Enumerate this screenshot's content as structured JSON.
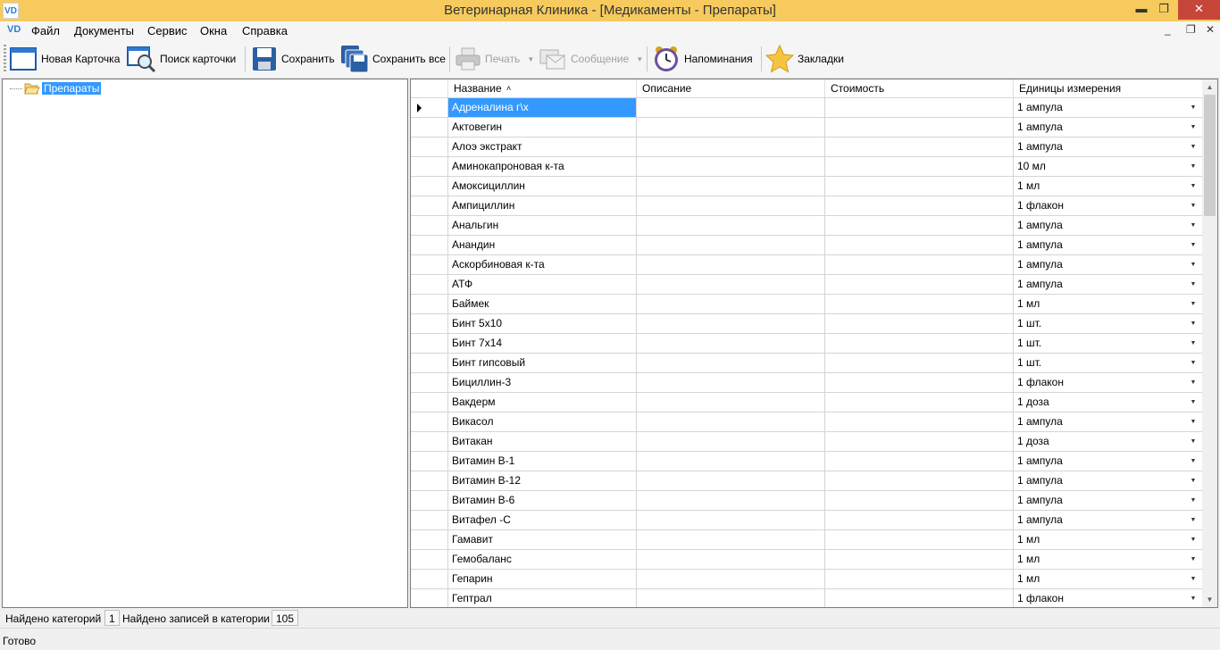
{
  "window": {
    "app_icon_text": "VD",
    "title": "Ветеринарная Клиника - [Медикаменты - Препараты]",
    "minimize": "▬",
    "maximize": "❐",
    "close": "✕"
  },
  "menu": {
    "icon_text": "VD",
    "items": [
      "Файл",
      "Документы",
      "Сервис",
      "Окна",
      "Справка"
    ],
    "mdi_minimize": "_",
    "mdi_restore": "❐",
    "mdi_close": "✕"
  },
  "toolbar": {
    "new_card": "Новая Карточка",
    "search_card": "Поиск карточки",
    "save": "Сохранить",
    "save_all": "Сохранить все",
    "print": "Печать",
    "message": "Сообщение",
    "reminders": "Напоминания",
    "bookmarks": "Закладки"
  },
  "tree": {
    "root_label": "Препараты"
  },
  "grid": {
    "columns": [
      "Название",
      "Описание",
      "Стоимость",
      "Единицы измерения"
    ],
    "sort_indicator": "˄",
    "rows": [
      {
        "name": "Адреналина г\\х",
        "description": "",
        "cost": "",
        "unit": "1 ампула"
      },
      {
        "name": "Актовегин",
        "description": "",
        "cost": "",
        "unit": "1 ампула"
      },
      {
        "name": "Алоэ экстракт",
        "description": "",
        "cost": "",
        "unit": "1 ампула"
      },
      {
        "name": "Аминокапроновая к-та",
        "description": "",
        "cost": "",
        "unit": "10 мл"
      },
      {
        "name": "Амоксициллин",
        "description": "",
        "cost": "",
        "unit": "1 мл"
      },
      {
        "name": "Ампициллин",
        "description": "",
        "cost": "",
        "unit": "1 флакон"
      },
      {
        "name": "Анальгин",
        "description": "",
        "cost": "",
        "unit": "1 ампула"
      },
      {
        "name": "Анандин",
        "description": "",
        "cost": "",
        "unit": "1 ампула"
      },
      {
        "name": "Аскорбиновая к-та",
        "description": "",
        "cost": "",
        "unit": "1 ампула"
      },
      {
        "name": "АТФ",
        "description": "",
        "cost": "",
        "unit": "1 ампула"
      },
      {
        "name": "Баймек",
        "description": "",
        "cost": "",
        "unit": "1 мл"
      },
      {
        "name": "Бинт 5х10",
        "description": "",
        "cost": "",
        "unit": "1 шт."
      },
      {
        "name": "Бинт 7х14",
        "description": "",
        "cost": "",
        "unit": "1 шт."
      },
      {
        "name": "Бинт гипсовый",
        "description": "",
        "cost": "",
        "unit": "1 шт."
      },
      {
        "name": "Бициллин-3",
        "description": "",
        "cost": "",
        "unit": "1 флакон"
      },
      {
        "name": "Вакдерм",
        "description": "",
        "cost": "",
        "unit": "1 доза"
      },
      {
        "name": "Викасол",
        "description": "",
        "cost": "",
        "unit": "1 ампула"
      },
      {
        "name": "Витакан",
        "description": "",
        "cost": "",
        "unit": "1 доза"
      },
      {
        "name": "Витамин В-1",
        "description": "",
        "cost": "",
        "unit": "1 ампула"
      },
      {
        "name": "Витамин В-12",
        "description": "",
        "cost": "",
        "unit": "1 ампула"
      },
      {
        "name": "Витамин В-6",
        "description": "",
        "cost": "",
        "unit": "1 ампула"
      },
      {
        "name": "Витафел -С",
        "description": "",
        "cost": "",
        "unit": "1 ампула"
      },
      {
        "name": "Гамавит",
        "description": "",
        "cost": "",
        "unit": "1 мл"
      },
      {
        "name": "Гемобаланс",
        "description": "",
        "cost": "",
        "unit": "1 мл"
      },
      {
        "name": "Гепарин",
        "description": "",
        "cost": "",
        "unit": "1 мл"
      },
      {
        "name": "Гептрал",
        "description": "",
        "cost": "",
        "unit": "1 флакон"
      }
    ]
  },
  "info": {
    "categories_label": "Найдено категорий",
    "categories_count": "1",
    "records_label": "Найдено записей в категории",
    "records_count": "105"
  },
  "status": {
    "text": "Готово"
  },
  "colors": {
    "titlebar": "#f7ca5e",
    "selection": "#3399ff",
    "close_button": "#c7463a"
  }
}
